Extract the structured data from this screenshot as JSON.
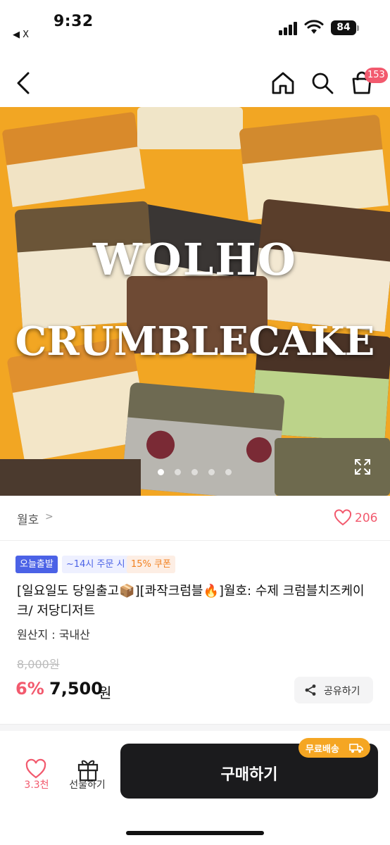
{
  "status": {
    "time": "9:32",
    "back_app": "◀ X",
    "battery": "84"
  },
  "nav": {
    "cart_count": "153"
  },
  "hero": {
    "line1": "WOLHO",
    "line2": "CRUMBLECAKE",
    "total_slides": 5,
    "current_slide": 1,
    "colors": {
      "background": "#f2a623"
    }
  },
  "brand": {
    "name": "월호",
    "chevron": ">",
    "likes": "206"
  },
  "badges": {
    "today": "오늘출발",
    "order": "~14시 주문 시",
    "coupon": "15% 쿠폰"
  },
  "product": {
    "title": "[일요일도 당일출고📦][콰작크럼블🔥]월호: 수제 크럼블치즈케이크/ 저당디저트",
    "origin": "원산지 : 국내산",
    "original_price": "8,000원",
    "discount": "6%",
    "price": "7,500",
    "price_unit": "원",
    "share": "공유하기"
  },
  "bottom": {
    "like_count": "3.3천",
    "gift": "선물하기",
    "buy": "구매하기",
    "free_shipping": "무료배송"
  },
  "icons": [
    "back-arrow-icon",
    "home-icon",
    "search-icon",
    "shopping-bag-icon",
    "heart-icon",
    "share-icon",
    "gift-icon",
    "truck-icon",
    "expand-icon"
  ],
  "colors": {
    "accent": "#f25a6e",
    "today_badge": "#4b62e6",
    "coupon_text": "#f1801f",
    "buy_button": "#1b1b1d",
    "free_shipping": "#f5a623"
  }
}
